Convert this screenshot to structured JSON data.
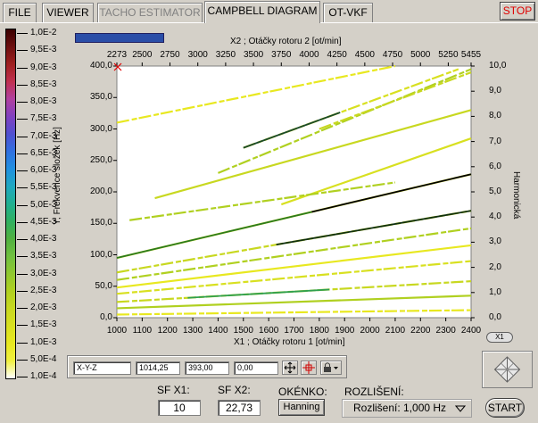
{
  "tabs": [
    {
      "label": "FILE",
      "state": "normal"
    },
    {
      "label": "VIEWER",
      "state": "normal"
    },
    {
      "label": "TACHO ESTIMATOR",
      "state": "disabled"
    },
    {
      "label": "CAMPBELL DIAGRAM",
      "state": "active"
    },
    {
      "label": "OT-VKF",
      "state": "normal"
    }
  ],
  "stop_label": "STOP",
  "colorscale": {
    "labels": [
      "1,0E-2",
      "9,5E-3",
      "9,0E-3",
      "8,5E-3",
      "8,0E-3",
      "7,5E-3",
      "7,0E-3",
      "6,5E-3",
      "6,0E-3",
      "5,5E-3",
      "5,0E-3",
      "4,5E-3",
      "4,0E-3",
      "3,5E-3",
      "3,0E-3",
      "2,5E-3",
      "2,0E-3",
      "1,5E-3",
      "1,0E-3",
      "5,0E-4",
      "1,0E-4"
    ],
    "colors": [
      "#3a0000",
      "#6e1010",
      "#a02020",
      "#c03050",
      "#b040a0",
      "#8040c0",
      "#5050d0",
      "#3070e0",
      "#2090e0",
      "#20a8c0",
      "#20b090",
      "#30b060",
      "#50b040",
      "#70c040",
      "#90c830",
      "#b0d020",
      "#c8d820",
      "#d8e020",
      "#e8e820",
      "#f0f040",
      "#ffffff"
    ]
  },
  "graph": {
    "x2_title": "X2 ; Otáčky rotoru 2 [ot/min]",
    "x2_ticks": [
      "2273",
      "2500",
      "2750",
      "3000",
      "3250",
      "3500",
      "3750",
      "4000",
      "4250",
      "4500",
      "4750",
      "5000",
      "5250",
      "5455"
    ],
    "x1_title": "X1 ; Otáčky rotoru 1 [ot/min]",
    "x1_ticks": [
      "1000",
      "1100",
      "1200",
      "1300",
      "1400",
      "1500",
      "1600",
      "1700",
      "1800",
      "1900",
      "2000",
      "2100",
      "2200",
      "2300",
      "2400"
    ],
    "y_title": "Y; Frekvence složek [Hz]",
    "y_ticks": [
      "400,0",
      "350,0",
      "300,0",
      "250,0",
      "200,0",
      "150,0",
      "100,0",
      "50,0",
      "0,0"
    ],
    "y2_title": "Harmonická",
    "y2_ticks": [
      "10,0",
      "9,0",
      "8,0",
      "7,0",
      "6,0",
      "5,0",
      "4,0",
      "3,0",
      "2,0",
      "1,0",
      "0,0"
    ],
    "x1_button": "X1"
  },
  "cursor": {
    "name": "X-Y-Z",
    "x": "1014,25",
    "y": "393,00",
    "z": "0,00"
  },
  "controls": {
    "sfx1_label": "SF X1:",
    "sfx1_value": "10",
    "sfx2_label": "SF X2:",
    "sfx2_value": "22,73",
    "window_label": "OKÉNKO:",
    "window_value": "Hanning",
    "resolution_label": "ROZLIŠENÍ:",
    "resolution_value": "Rozlišení: 1,000 Hz",
    "start_label": "START"
  },
  "chart_data": {
    "type": "heatmap",
    "xlabel": "X1 ; Otáčky rotoru 1 [ot/min]",
    "x2label": "X2 ; Otáčky rotoru 2 [ot/min]",
    "ylabel": "Y; Frekvence složek [Hz]",
    "y2label": "Harmonická",
    "xlim": [
      1000,
      2400
    ],
    "x2lim": [
      2273,
      5455
    ],
    "ylim": [
      0,
      400
    ],
    "y2lim": [
      0,
      10
    ],
    "zlim": [
      0.0001,
      0.01
    ],
    "orders": [
      {
        "x": [
          1000,
          2400
        ],
        "y": [
          95,
          228
        ]
      },
      {
        "x": [
          1000,
          2400
        ],
        "y": [
          72,
          170
        ]
      },
      {
        "x": [
          1000,
          2400
        ],
        "y": [
          60,
          142
        ]
      },
      {
        "x": [
          1000,
          2400
        ],
        "y": [
          48,
          115
        ]
      },
      {
        "x": [
          1000,
          2400
        ],
        "y": [
          38,
          90
        ]
      },
      {
        "x": [
          1000,
          2400
        ],
        "y": [
          25,
          58
        ]
      },
      {
        "x": [
          1000,
          2400
        ],
        "y": [
          15,
          35
        ]
      },
      {
        "x": [
          1000,
          2400
        ],
        "y": [
          5,
          12
        ]
      },
      {
        "x": [
          1500,
          2350
        ],
        "y": [
          270,
          395
        ]
      },
      {
        "x": [
          1150,
          2400
        ],
        "y": [
          190,
          330
        ]
      },
      {
        "x": [
          1400,
          2400
        ],
        "y": [
          230,
          395
        ]
      },
      {
        "x": [
          1000,
          2100
        ],
        "y": [
          310,
          400
        ]
      },
      {
        "x": [
          1650,
          2400
        ],
        "y": [
          180,
          285
        ]
      },
      {
        "x": [
          1800,
          2400
        ],
        "y": [
          300,
          390
        ]
      },
      {
        "x": [
          1050,
          2100
        ],
        "y": [
          155,
          215
        ]
      }
    ],
    "grid": false
  }
}
